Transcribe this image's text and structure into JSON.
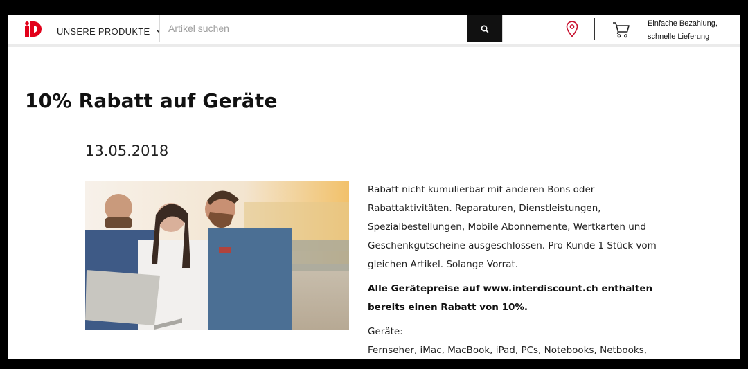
{
  "header": {
    "menu_label": "UNSERE PRODUKTE",
    "search_placeholder": "Artikel suchen",
    "tagline_line1": "Einfache Bezahlung,",
    "tagline_line2": "schnelle Lieferung"
  },
  "article": {
    "title": "10% Rabatt auf Geräte",
    "date": "13.05.2018",
    "para1": "Rabatt nicht kumulierbar mit anderen Bons oder Rabattaktivitäten. Reparaturen, Dienstleistungen, Spezialbestellungen, Mobile Abonnemente, Wertkarten und Geschenkgutscheine ausgeschlossen. Pro Kunde 1 Stück vom gleichen Artikel. Solange Vorrat.",
    "para2": "Alle Gerätepreise auf www.interdiscount.ch enthalten bereits einen Rabatt von 10%.",
    "devices_heading": "Geräte:",
    "devices_list": "Fernseher, iMac, MacBook, iPad, PCs, Notebooks, Netbooks, Tablets,"
  },
  "colors": {
    "brand_red": "#e2001a",
    "location_pin": "#c8102e",
    "search_button": "#111111"
  },
  "icons": [
    "brand-logo",
    "chevron-down-icon",
    "search-icon",
    "location-pin-icon",
    "cart-icon"
  ]
}
